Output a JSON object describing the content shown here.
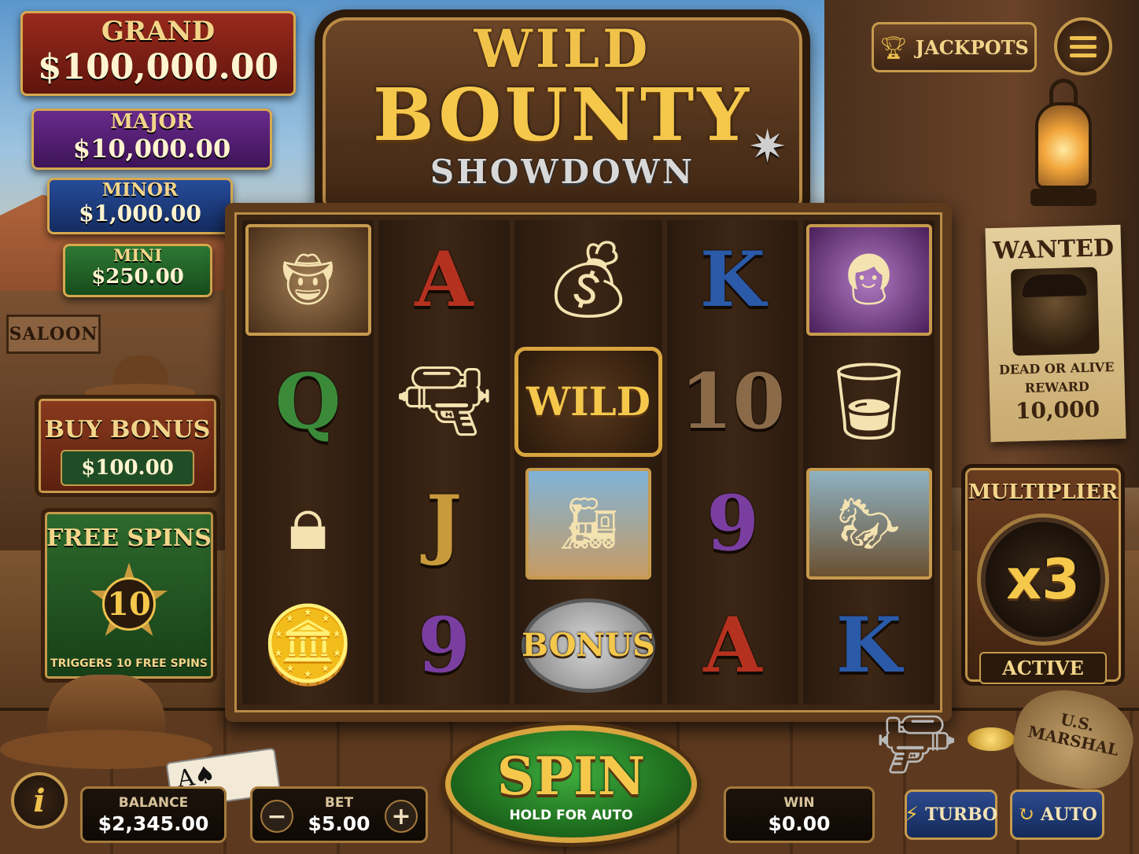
{
  "title": {
    "line1": "WILD",
    "line2": "BOUNTY",
    "line3": "SHOWDOWN"
  },
  "jackpots": {
    "grand": {
      "name": "GRAND",
      "value": "$100,000.00"
    },
    "major": {
      "name": "MAJOR",
      "value": "$10,000.00"
    },
    "minor": {
      "name": "MINOR",
      "value": "$1,000.00"
    },
    "mini": {
      "name": "MINI",
      "value": "$250.00"
    }
  },
  "header": {
    "jackpots_label": "JACKPOTS"
  },
  "scenery": {
    "saloon": "SALOON",
    "marshal_bag": "U.S. MARSHAL"
  },
  "buy_bonus": {
    "label": "BUY BONUS",
    "price": "$100.00"
  },
  "free_spins": {
    "label": "FREE SPINS",
    "count": "10",
    "subtitle": "TRIGGERS 10 FREE SPINS"
  },
  "wanted": {
    "title": "WANTED",
    "line1": "DEAD OR ALIVE",
    "line2": "REWARD",
    "amount": "10,000"
  },
  "multiplier": {
    "label": "MULTIPLIER",
    "value": "x3",
    "status": "ACTIVE"
  },
  "reels": [
    [
      "outlaw",
      "Q",
      "safe",
      "gold-coins"
    ],
    [
      "A",
      "revolver",
      "J",
      "9"
    ],
    [
      "money-bag",
      "WILD",
      "train",
      "BONUS"
    ],
    [
      "K",
      "10",
      "9",
      "A"
    ],
    [
      "cowgirl",
      "whiskey",
      "rider",
      "K"
    ]
  ],
  "reel_symbols": {
    "A": {
      "text": "A",
      "color": "#b5311f"
    },
    "K": {
      "text": "K",
      "color": "#2a5aa8"
    },
    "Q": {
      "text": "Q",
      "color": "#3b8a3a"
    },
    "J": {
      "text": "J",
      "color": "#c89a3c"
    },
    "10": {
      "text": "10",
      "color": "#8a6a48"
    },
    "9": {
      "text": "9",
      "color": "#7a3ea0"
    },
    "WILD": {
      "text": "WILD"
    },
    "BONUS": {
      "text": "BONUS"
    }
  },
  "controls": {
    "balance_label": "BALANCE",
    "balance_value": "$2,345.00",
    "bet_label": "BET",
    "bet_value": "$5.00",
    "bet_minus": "−",
    "bet_plus": "+",
    "win_label": "WIN",
    "win_value": "$0.00",
    "spin_label": "SPIN",
    "spin_sub": "HOLD FOR AUTO",
    "turbo_label": "TURBO",
    "auto_label": "AUTO",
    "info_label": "i"
  },
  "icons": {
    "trophy": "trophy-icon",
    "menu": "hamburger-menu-icon",
    "turbo": "lightning-icon",
    "auto": "refresh-icon"
  }
}
